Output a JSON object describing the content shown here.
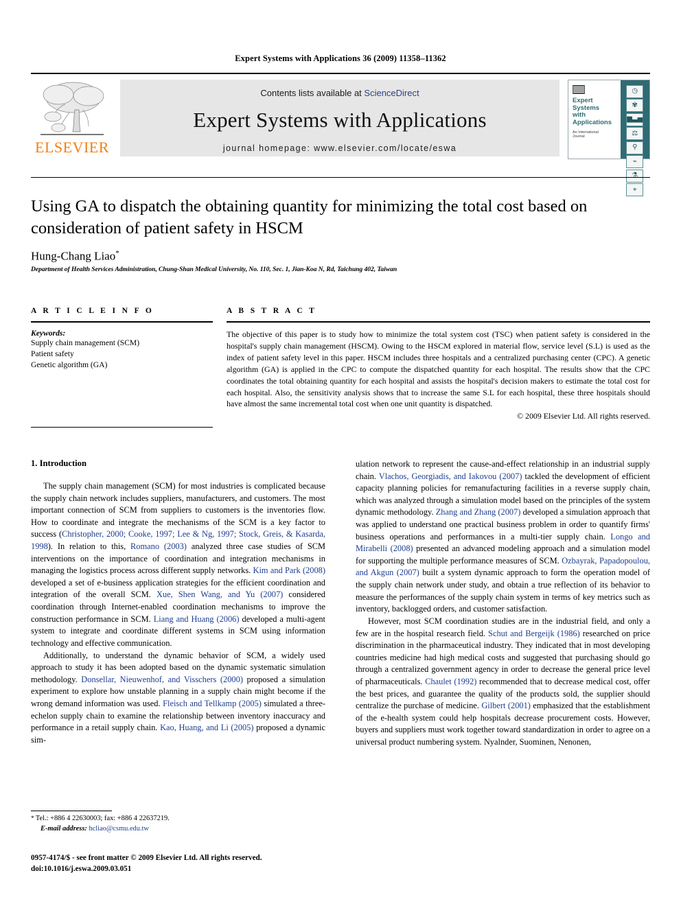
{
  "running_head": "Expert Systems with Applications 36 (2009) 11358–11362",
  "header": {
    "contents_prefix": "Contents lists available at ",
    "sciencedirect": "ScienceDirect",
    "journal_title": "Expert Systems with Applications",
    "homepage": "journal homepage: www.elsevier.com/locate/eswa",
    "publisher_logo_text": "ELSEVIER",
    "publisher_logo_icon": "elsevier-tree-icon",
    "accent_orange": "#f07f14",
    "link_blue": "#2b3f8c",
    "cover": {
      "journal_name_lines": [
        "Expert",
        "Systems",
        "with",
        "Applications"
      ],
      "subtitle_lines": [
        "An International",
        "Journal"
      ],
      "teal": "#2f6b74",
      "icons": [
        "clock-icon",
        "gear-icon",
        "bar-chart-icon",
        "scales-icon",
        "microscope-icon",
        "satellite-icon",
        "lab-flask-icon",
        "pipette-icon"
      ]
    }
  },
  "title": "Using GA to dispatch the obtaining quantity for minimizing the total cost based on consideration of patient safety in HSCM",
  "author": "Hung-Chang Liao",
  "author_marker": "*",
  "affiliation": "Department of Health Services Administration, Chung-Shan Medical University, No. 110, Sec. 1, Jian-Koa N, Rd, Taichung 402, Taiwan",
  "article_info": {
    "heading": "A R T I C L E    I N F O",
    "keywords_label": "Keywords:",
    "keywords": [
      "Supply chain management (SCM)",
      "Patient safety",
      "Genetic algorithm (GA)"
    ]
  },
  "abstract": {
    "heading": "A B S T R A C T",
    "text": "The objective of this paper is to study how to minimize the total system cost (TSC) when patient safety is considered in the hospital's supply chain management (HSCM). Owing to the HSCM explored in material flow, service level (S.L) is used as the index of patient safety level in this paper. HSCM includes three hospitals and a centralized purchasing center (CPC). A genetic algorithm (GA) is applied in the CPC to compute the dispatched quantity for each hospital. The results show that the CPC coordinates the total obtaining quantity for each hospital and assists the hospital's decision makers to estimate the total cost for each hospital. Also, the sensitivity analysis shows that to increase the same S.L for each hospital, these three hospitals should have almost the same incremental total cost when one unit quantity is dispatched.",
    "copyright": "© 2009 Elsevier Ltd. All rights reserved."
  },
  "section": {
    "number_title": "1. Introduction"
  },
  "body": {
    "left_paragraphs": [
      "The supply chain management (SCM) for most industries is complicated because the supply chain network includes suppliers, manufacturers, and customers. The most important connection of SCM from suppliers to customers is the inventories flow. How to coordinate and integrate the mechanisms of the SCM is a key factor to success (Christopher, 2000; Cooke, 1997; Lee & Ng, 1997; Stock, Greis, & Kasarda, 1998). In relation to this, Romano (2003) analyzed three case studies of SCM interventions on the importance of coordination and integration mechanisms in managing the logistics process across different supply networks. Kim and Park (2008) developed a set of e-business application strategies for the efficient coordination and integration of the overall SCM. Xue, Shen Wang, and Yu (2007) considered coordination through Internet-enabled coordination mechanisms to improve the construction performance in SCM. Liang and Huang (2006) developed a multi-agent system to integrate and coordinate different systems in SCM using information technology and effective communication.",
      "Additionally, to understand the dynamic behavior of SCM, a widely used approach to study it has been adopted based on the dynamic systematic simulation methodology. Donsellar, Nieuwenhof, and Visschers (2000) proposed a simulation experiment to explore how unstable planning in a supply chain might become if the wrong demand information was used. Fleisch and Tellkamp (2005) simulated a three-echelon supply chain to examine the relationship between inventory inaccuracy and performance in a retail supply chain. Kao, Huang, and Li (2005) proposed a dynamic sim-"
    ],
    "right_paragraphs": [
      "ulation network to represent the cause-and-effect relationship in an industrial supply chain. Vlachos, Georgiadis, and Iakovou (2007) tackled the development of efficient capacity planning policies for remanufacturing facilities in a reverse supply chain, which was analyzed through a simulation model based on the principles of the system dynamic methodology. Zhang and Zhang (2007) developed a simulation approach that was applied to understand one practical business problem in order to quantify firms' business operations and performances in a multi-tier supply chain. Longo and Mirabelli (2008) presented an advanced modeling approach and a simulation model for supporting the multiple performance measures of SCM. Ozbayrak, Papadopoulou, and Akgun (2007) built a system dynamic approach to form the operation model of the supply chain network under study, and obtain a true reflection of its behavior to measure the performances of the supply chain system in terms of key metrics such as inventory, backlogged orders, and customer satisfaction.",
      "However, most SCM coordination studies are in the industrial field, and only a few are in the hospital research field. Schut and Bergeijk (1986) researched on price discrimination in the pharmaceutical industry. They indicated that in most developing countries medicine had high medical costs and suggested that purchasing should go through a centralized government agency in order to decrease the general price level of pharmaceuticals. Chaulet (1992) recommended that to decrease medical cost, offer the best prices, and guarantee the quality of the products sold, the supplier should centralize the purchase of medicine. Gilbert (2001) emphasized that the establishment of the e-health system could help hospitals decrease procurement costs. However, buyers and suppliers must work together toward standardization in order to agree on a universal product numbering system. Nyalnder, Suominen, Nenonen,"
    ],
    "reference_color": "#1d3d8f"
  },
  "footnote": {
    "marker": "*",
    "tel": "Tel.: +886 4 22630003; fax: +886 4 22637219.",
    "email_label": "E-mail address:",
    "email": "hcliao@csmu.edu.tw"
  },
  "imprint": {
    "line1": "0957-4174/$ - see front matter © 2009 Elsevier Ltd. All rights reserved.",
    "line2": "doi:10.1016/j.eswa.2009.03.051"
  }
}
